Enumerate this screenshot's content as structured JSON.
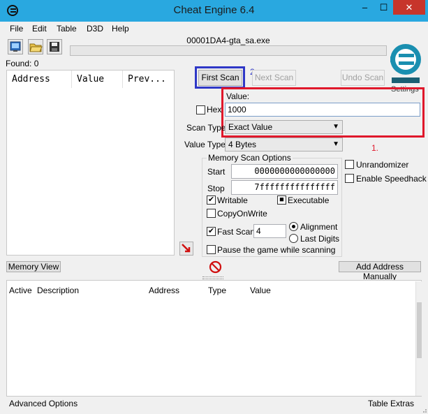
{
  "window": {
    "title": "Cheat Engine 6.4",
    "minimize_glyph": "‒",
    "maximize_glyph": "☐",
    "close_glyph": "✕"
  },
  "menu": {
    "file": "File",
    "edit": "Edit",
    "table": "Table",
    "d3d": "D3D",
    "help": "Help"
  },
  "toolbar": {
    "icons": [
      "select-process-icon",
      "open-file-icon",
      "save-file-icon"
    ]
  },
  "process": {
    "name": "00001DA4-gta_sa.exe"
  },
  "results": {
    "found_label": "Found: 0",
    "columns": [
      "Address",
      "Value",
      "Prev..."
    ]
  },
  "scan": {
    "first_scan": "First Scan",
    "next_scan": "Next Scan",
    "undo_scan": "Undo Scan",
    "settings": "Settings",
    "annotation_1": "1.",
    "annotation_2": "2",
    "value_label": "Value:",
    "value": "1000",
    "hex_label": "Hex",
    "scan_type_label": "Scan Type",
    "scan_type": "Exact Value",
    "value_type_label": "Value Type",
    "value_type": "4 Bytes"
  },
  "memory_options": {
    "title": "Memory Scan Options",
    "start_label": "Start",
    "start_value": "0000000000000000",
    "stop_label": "Stop",
    "stop_value": "7fffffffffffffff",
    "writable": "Writable",
    "executable": "Executable",
    "copy_on_write": "CopyOnWrite",
    "fast_scan": "Fast Scan",
    "fast_scan_value": "4",
    "alignment": "Alignment",
    "last_digits": "Last Digits",
    "pause": "Pause the game while scanning",
    "check_mark": "✔",
    "filled_mark": "■"
  },
  "extras": {
    "unrandomizer": "Unrandomizer",
    "speedhack": "Enable Speedhack"
  },
  "bottom": {
    "memory_view": "Memory View",
    "add_address": "Add Address Manually",
    "address_columns": {
      "active": "Active",
      "description": "Description",
      "address": "Address",
      "type": "Type",
      "value": "Value"
    },
    "advanced_options": "Advanced Options",
    "table_extras": "Table Extras"
  },
  "colors": {
    "titlebar": "#29a8e0",
    "highlight_blue": "#2f38c7",
    "highlight_red": "#e0182b",
    "close": "#c7352b"
  }
}
